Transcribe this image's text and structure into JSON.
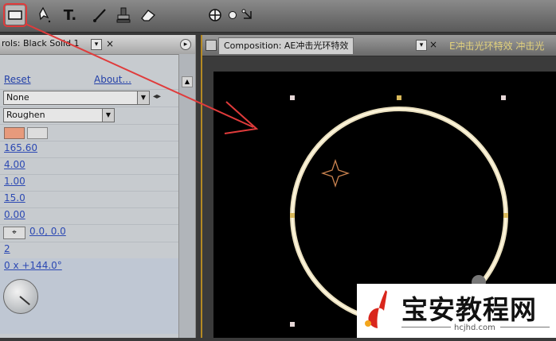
{
  "toolbar": {
    "icons": [
      "rectangle-mask-icon",
      "pen-icon",
      "type-icon",
      "brush-icon",
      "clone-stamp-icon",
      "eraser-icon",
      "orbit-icon",
      "dot-icon",
      "axis-icon"
    ],
    "type_tool_label": "T."
  },
  "effect_controls": {
    "tab_title": "rols: Black Solid 1",
    "reset_label": "Reset",
    "about_label": "About...",
    "none_option": "None",
    "roughen_option": "Roughen",
    "values": [
      "165.60",
      "4.00",
      "1.00",
      "15.0",
      "0.00"
    ],
    "point_value": "0.0, 0.0",
    "count_value": "2",
    "angle_value": "0 x +144.0°"
  },
  "composition": {
    "tab_label": "Composition: AE冲击光环特效",
    "tab2_label": "E冲击光环特效  冲击光",
    "ring_color": "#efe6c4"
  },
  "watermark": {
    "title": "宝安教程网",
    "subtitle": "hcjhd.com",
    "logo_color": "#d9261c"
  },
  "annotation": {
    "color": "#e03b3b"
  }
}
